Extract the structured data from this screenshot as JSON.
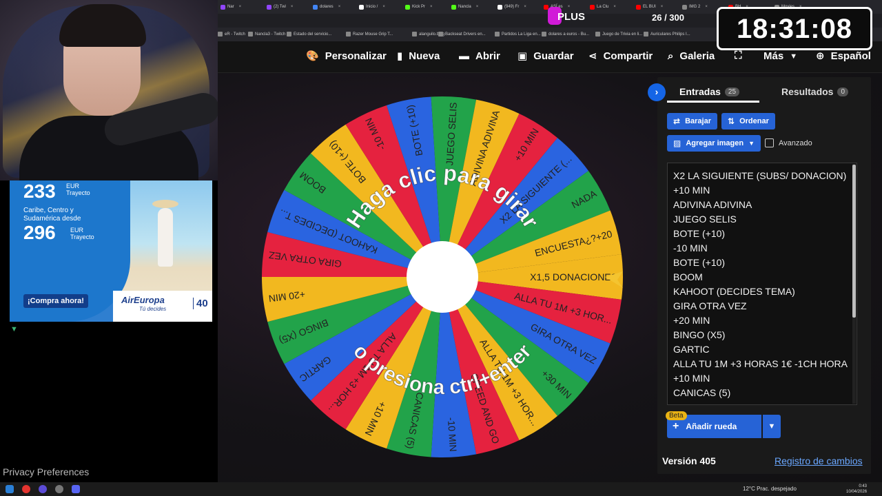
{
  "browser": {
    "tabs": [
      {
        "label": "Nar",
        "color": "#9146ff"
      },
      {
        "label": "(2) Twi",
        "color": "#9146ff"
      },
      {
        "label": "dolares",
        "color": "#4285f4"
      },
      {
        "label": "Inicio /",
        "color": "#ffffff"
      },
      {
        "label": "Kick Pr",
        "color": "#53fc18"
      },
      {
        "label": "Nancla",
        "color": "#53fc18"
      },
      {
        "label": "(949) Fr",
        "color": "#ffffff"
      },
      {
        "label": "ASÍ es",
        "color": "#ff0000"
      },
      {
        "label": "La Clu",
        "color": "#ff0000"
      },
      {
        "label": "EL BUI",
        "color": "#ff0000"
      },
      {
        "label": "IMG 2",
        "color": "#888888"
      },
      {
        "label": "BH",
        "color": "#ff0000"
      },
      {
        "label": "Movies",
        "color": "#888888"
      }
    ],
    "bookmarks": [
      "eR - Twitch",
      "Nancla3 - Twitch",
      "Estado del servicio...",
      "Razer Mouse Grip T...",
      "alanguilo.blog",
      "Backseat Drivers en...",
      "Partidos La Liga en...",
      "dolares a euros - Bu...",
      "Juego de Trivia en li...",
      "Auriculares Philips I..."
    ]
  },
  "nav": {
    "customize": "Personalizar",
    "new": "Nueva",
    "open": "Abrir",
    "save": "Guardar",
    "share": "Compartir",
    "gallery": "Galeria",
    "more": "Más",
    "language": "Español"
  },
  "wheel": {
    "prompt_top": "Haga clic para girar",
    "prompt_bottom": "o presiona ctrl+enter",
    "segment_colors": [
      "#f2b81f",
      "#e5223f",
      "#2a64e0",
      "#22a34a"
    ],
    "segments": [
      "X1,5 DONACIONES",
      "ALLA TU 1M +3 HOR...",
      "GIRA OTRA VEZ",
      "+30 MIN",
      "ALLA TU 1M +3 HOR...",
      "SPEED AND GO",
      "-10 MIN",
      "CANICAS (5)",
      "+10 MIN",
      "ALLA TU 1M +3 HOR...",
      "GARTIC",
      "BINGO (X5)",
      "+20 MIN",
      "GIRA OTRA VEZ",
      "KAHOOT (DECIDES T...",
      "BOOM",
      "BOTE (+10)",
      "-10 MIN",
      "BOTE (+10)",
      "JUEGO SELIS",
      "ADIVINA ADIVINA",
      "+10 MIN",
      "X2 LA SIGUIENTE (...",
      "NADA",
      "ENCUESTA¿?+20"
    ]
  },
  "panel": {
    "toggle": "›",
    "entries_tab": "Entradas",
    "entries_count": "25",
    "results_tab": "Resultados",
    "results_count": "0",
    "shuffle": "Barajar",
    "sort": "Ordenar",
    "add_image": "Agregar imagen",
    "advanced": "Avanzado",
    "entries": [
      "X2 LA SIGUIENTE (SUBS/ DONACION)",
      "+10 MIN",
      "ADIVINA ADIVINA",
      "JUEGO SELIS",
      "BOTE (+10)",
      "-10 MIN",
      "BOTE (+10)",
      "BOOM",
      "KAHOOT (DECIDES TEMA)",
      "GIRA OTRA VEZ",
      "+20 MIN",
      "BINGO (X5)",
      "GARTIC",
      "ALLA TU 1M +3 HORAS 1€ -1CH HORA",
      "+10 MIN",
      "CANICAS (5)"
    ],
    "beta": "Beta",
    "add_wheel": "Añadir rueda",
    "version": "Versión 405",
    "changelog": "Registro de cambios"
  },
  "overlay": {
    "plus": "PLUS",
    "counter": "26 / 300",
    "clock": "18:31:08"
  },
  "ad": {
    "price1": "233",
    "unit1a": "EUR",
    "unit1b": "Trayecto",
    "destinations": "Caribe, Centro y Sudamérica desde",
    "price2": "296",
    "unit2a": "EUR",
    "unit2b": "Trayecto",
    "cta": "¡Compra ahora!",
    "brand": "AirEuropa",
    "tagline": "Tú decides",
    "anniversary": "40"
  },
  "privacy": "Privacy Preferences",
  "taskbar": {
    "weather": "12°C  Prac. despejado",
    "time": "0:43",
    "date": "10/04/2026"
  }
}
